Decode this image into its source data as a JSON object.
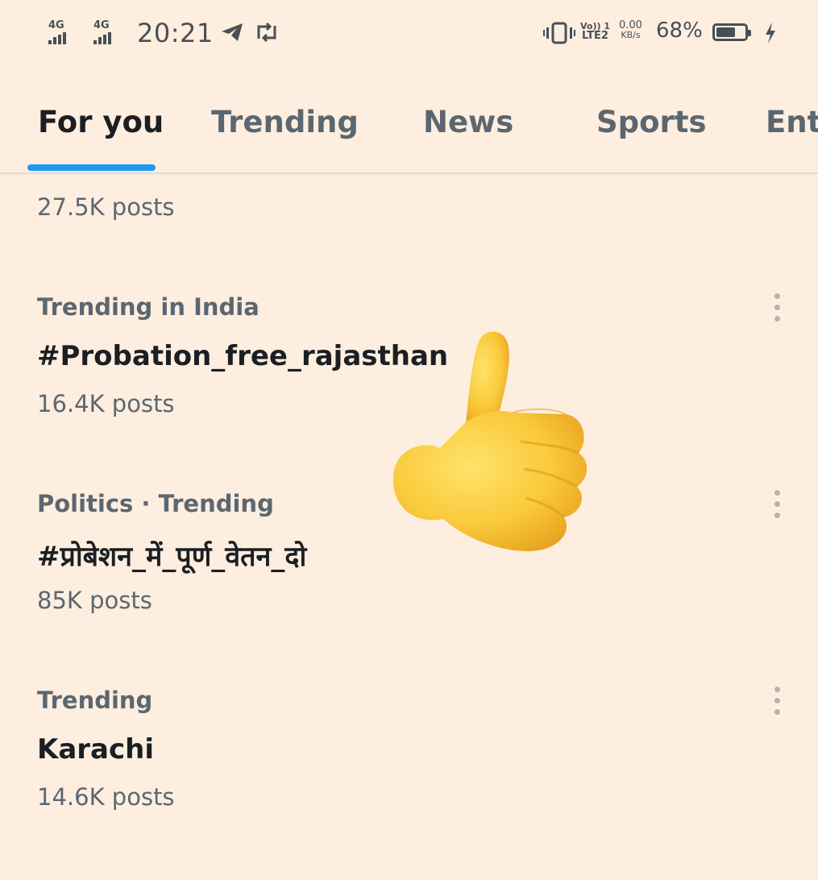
{
  "status_bar": {
    "sim1_label": "4G",
    "sim2_label": "4G",
    "time": "20:21",
    "volte_top": "Vo)) 1",
    "volte_bottom": "LTE2",
    "net_speed_value": "0.00",
    "net_speed_unit": "KB/s",
    "battery_percent": "68%",
    "battery_level": 0.68,
    "icons": [
      "telegram-icon",
      "retweet-icon",
      "vibrate-icon",
      "charging-icon"
    ]
  },
  "tabs": [
    {
      "label": "For you",
      "active": true
    },
    {
      "label": "Trending",
      "active": false
    },
    {
      "label": "News",
      "active": false
    },
    {
      "label": "Sports",
      "active": false
    },
    {
      "label": "Ente",
      "active": false
    }
  ],
  "accent_color": "#1d9bf0",
  "background_color": "#fdeee0",
  "top_partial_posts": "27.5K posts",
  "trends": [
    {
      "context": "Trending in India",
      "title": "#Probation_free_rajasthan",
      "posts": "16.4K posts"
    },
    {
      "context": "Politics · Trending",
      "title": "#प्रोबेशन_में_पूर्ण_वेतन_दो",
      "posts": "85K posts"
    },
    {
      "context": "Trending",
      "title": "Karachi",
      "posts": "14.6K posts"
    }
  ],
  "overlay_sticker": "thumbs-up-emoji"
}
